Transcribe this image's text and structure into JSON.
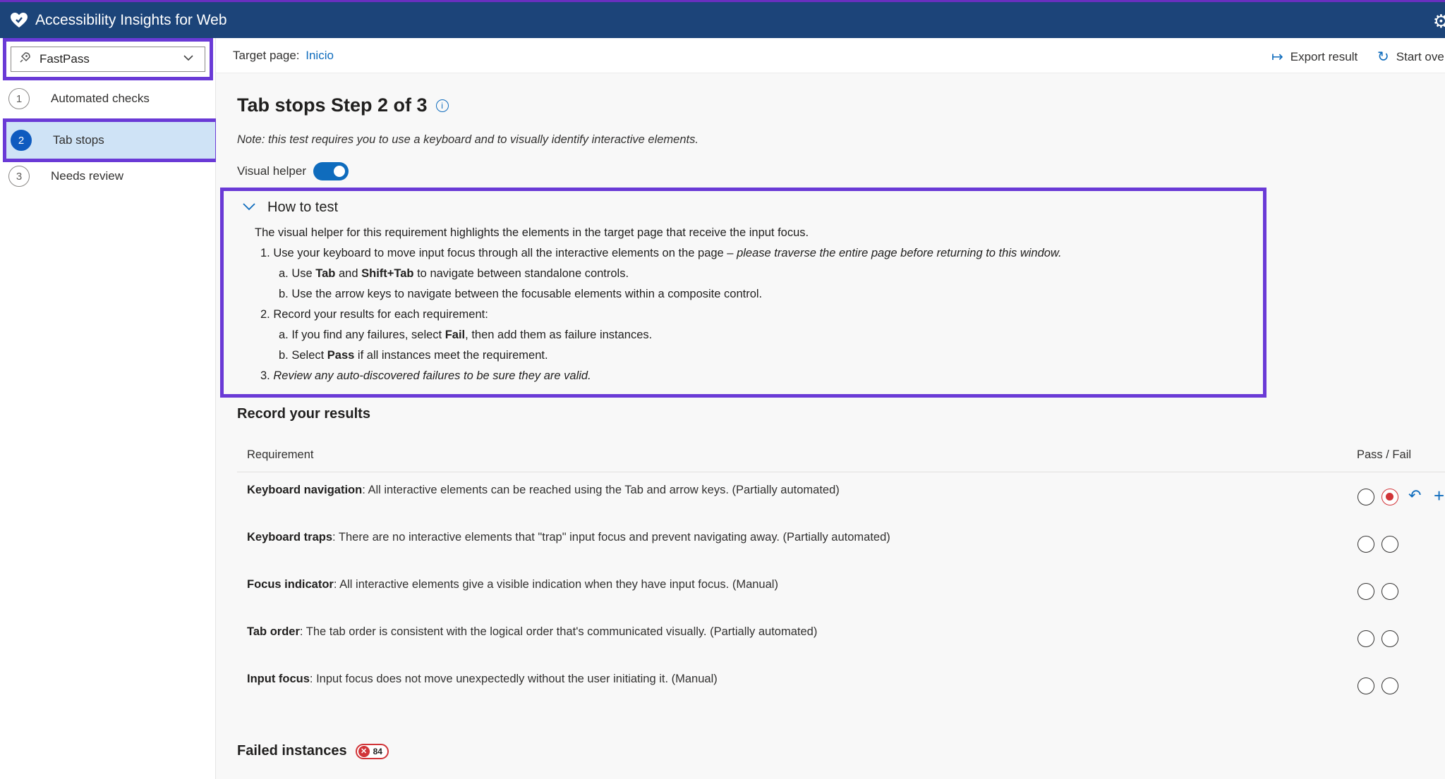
{
  "app": {
    "title": "Accessibility Insights for Web"
  },
  "sidebar": {
    "dropdown_value": "FastPass",
    "items": [
      {
        "number": "1",
        "label": "Automated checks"
      },
      {
        "number": "2",
        "label": "Tab stops"
      },
      {
        "number": "3",
        "label": "Needs review"
      }
    ]
  },
  "commandbar": {
    "target_label": "Target page:",
    "target_link": "Inicio",
    "export_label": "Export result",
    "start_over_label": "Start ove"
  },
  "content": {
    "heading": "Tab stops Step 2 of 3",
    "note": "Note: this test requires you to use a keyboard and to visually identify interactive elements.",
    "visual_helper_label": "Visual helper",
    "visual_helper_on": true
  },
  "how_to_test": {
    "title": "How to test",
    "intro": "The visual helper for this requirement highlights the elements in the target page that receive the input focus.",
    "step1_plain": "1. Use your keyboard to move input focus through all the interactive elements on the page – ",
    "step1_italic": "please traverse the entire page before returning to this window.",
    "step1a_pre": "a. Use ",
    "step1a_b1": "Tab",
    "step1a_mid": " and ",
    "step1a_b2": "Shift+Tab",
    "step1a_post": " to navigate between standalone controls.",
    "step1b": "b. Use the arrow keys to navigate between the focusable elements within a composite control.",
    "step2": "2. Record your results for each requirement:",
    "step2a_pre": "a. If you find any failures, select ",
    "step2a_b": "Fail",
    "step2a_post": ", then add them as failure instances.",
    "step2b_pre": "b. Select ",
    "step2b_b": "Pass",
    "step2b_post": " if all instances meet the requirement.",
    "step3_num": "3. ",
    "step3_italic": "Review any auto-discovered failures to be sure they are valid."
  },
  "results": {
    "title": "Record your results",
    "col_requirement": "Requirement",
    "col_passfail": "Pass / Fail",
    "rows": [
      {
        "name": "Keyboard navigation",
        "desc": ": All interactive elements can be reached using the Tab and arrow keys. (Partially automated)",
        "status": "fail"
      },
      {
        "name": "Keyboard traps",
        "desc": ": There are no interactive elements that \"trap\" input focus and prevent navigating away. (Partially automated)",
        "status": "none"
      },
      {
        "name": "Focus indicator",
        "desc": ": All interactive elements give a visible indication when they have input focus. (Manual)",
        "status": "none"
      },
      {
        "name": "Tab order",
        "desc": ": The tab order is consistent with the logical order that's communicated visually. (Partially automated)",
        "status": "none"
      },
      {
        "name": "Input focus",
        "desc": ": Input focus does not move unexpectedly without the user initiating it. (Manual)",
        "status": "none"
      }
    ]
  },
  "failed": {
    "title": "Failed instances",
    "count": "84"
  },
  "colors": {
    "titlebar": "#1c4479",
    "highlight": "#6a3ad6",
    "accent": "#0f6cbd",
    "fail": "#d13438",
    "selected_nav": "#cfe3f6"
  },
  "icons": {
    "logo": "heart-shield-icon",
    "settings": "gear-icon",
    "mode": "rocket-icon",
    "export": "export-arrow-icon",
    "start_over": "refresh-icon",
    "info": "info-icon",
    "undo": "undo-icon",
    "add": "plus-icon"
  }
}
